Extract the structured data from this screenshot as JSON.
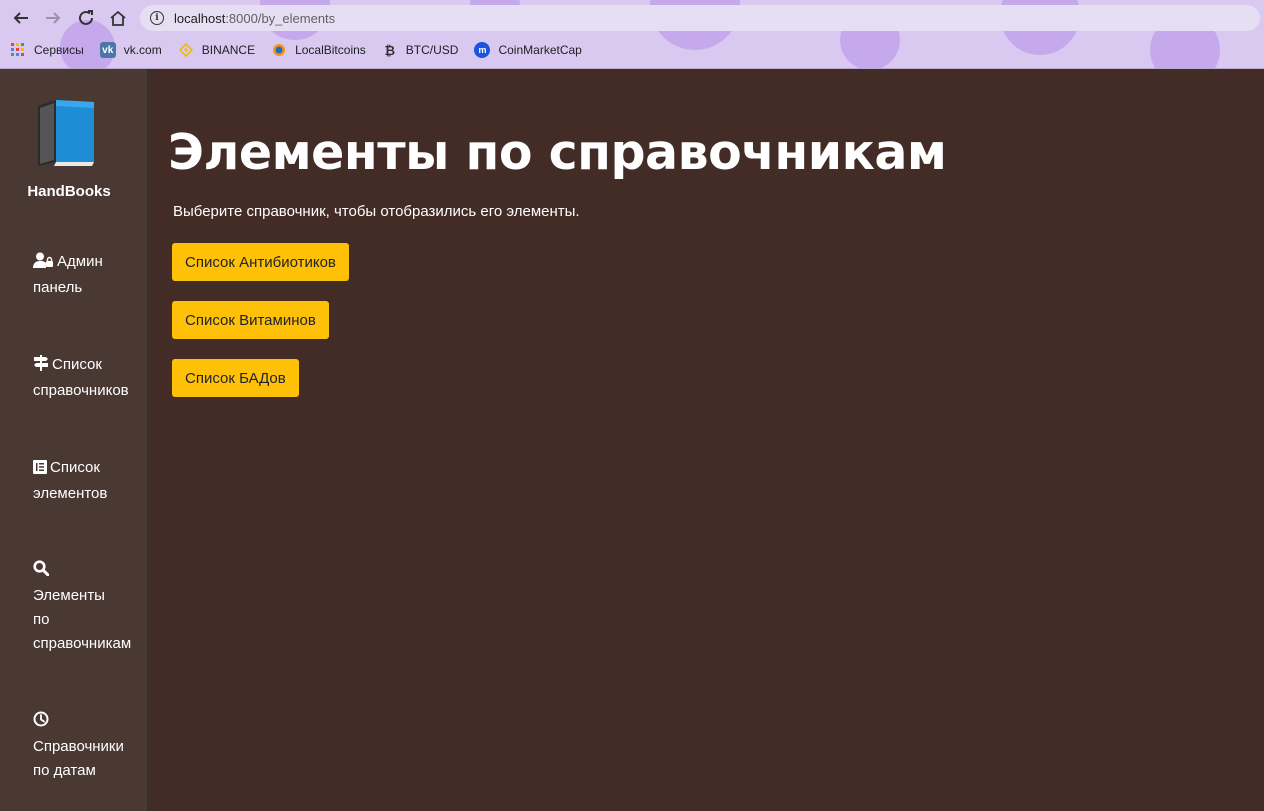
{
  "browser": {
    "url_host": "localhost",
    "url_path": ":8000/by_elements",
    "bookmarks": [
      {
        "label": "Сервисы",
        "icon": "apps-grid-icon"
      },
      {
        "label": "vk.com",
        "icon": "vk-icon"
      },
      {
        "label": "BINANCE",
        "icon": "binance-icon"
      },
      {
        "label": "LocalBitcoins",
        "icon": "localbitcoins-icon"
      },
      {
        "label": "BTC/USD",
        "icon": "bitcoin-icon"
      },
      {
        "label": "CoinMarketCap",
        "icon": "coinmarketcap-icon"
      }
    ]
  },
  "sidebar": {
    "brand": "HandBooks",
    "items": [
      {
        "line1": "Админ",
        "line2": "панель",
        "icon": "user-lock-icon"
      },
      {
        "line1": "Список",
        "line2": "справочников",
        "icon": "signpost-icon"
      },
      {
        "line1": "Список",
        "line2": "элементов",
        "icon": "list-box-icon"
      },
      {
        "line1": "Элементы",
        "line2": "по",
        "line3": "справочникам",
        "icon": "search-icon"
      },
      {
        "line1": "Справочники",
        "line2": "по датам",
        "icon": "clock-icon"
      }
    ]
  },
  "main": {
    "title": "Элементы по справочникам",
    "subtitle": "Выберите справочник, чтобы отобразились его элементы.",
    "buttons": [
      {
        "label": "Список Антибиотиков"
      },
      {
        "label": "Список Витаминов"
      },
      {
        "label": "Список БАДов"
      }
    ]
  },
  "colors": {
    "background": "#432c26",
    "sidebar": "#4a3833",
    "accent_button": "#ffc107"
  }
}
